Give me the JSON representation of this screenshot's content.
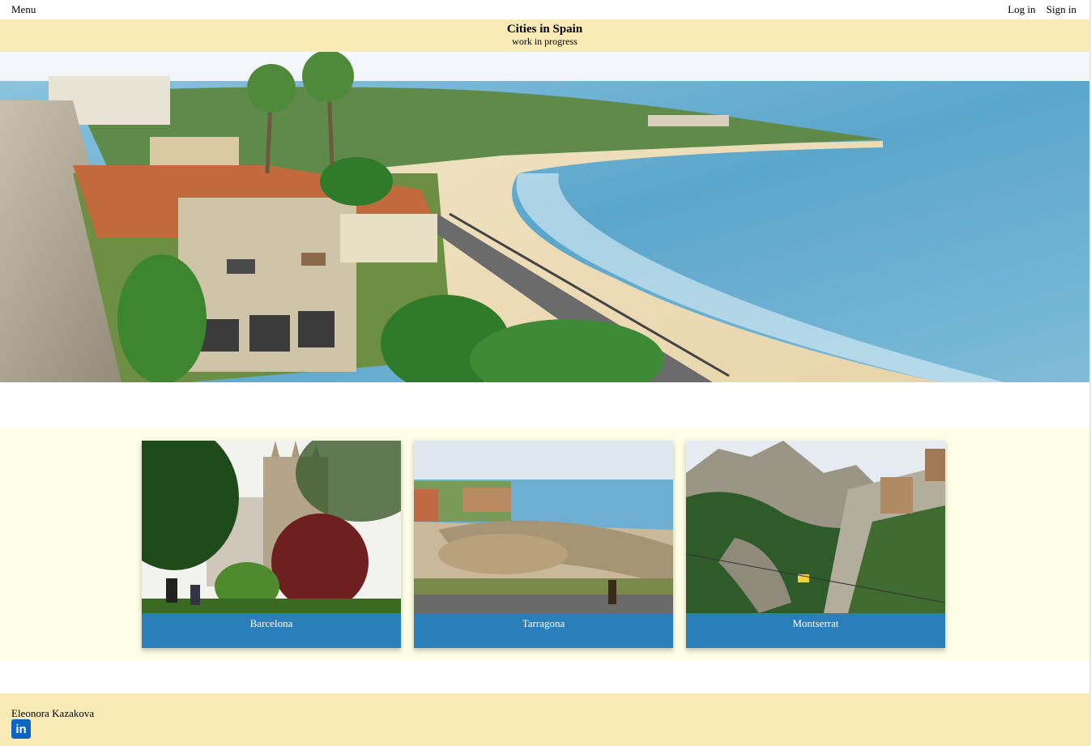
{
  "nav": {
    "menu_label": "Menu",
    "login_label": "Log in",
    "signin_label": "Sign in"
  },
  "header": {
    "title": "Cities in Spain",
    "subtitle": "work in progress"
  },
  "cards": [
    {
      "label": "Barcelona"
    },
    {
      "label": "Tarragona"
    },
    {
      "label": "Montserrat"
    }
  ],
  "footer": {
    "author": "Eleonora Kazakova",
    "linkedin_icon_text": "in"
  },
  "colors": {
    "header_bg": "#faebb6",
    "cards_band_bg": "#fefee6",
    "card_label_bg": "#2a7fba",
    "linkedin_blue": "#0a66c2"
  }
}
